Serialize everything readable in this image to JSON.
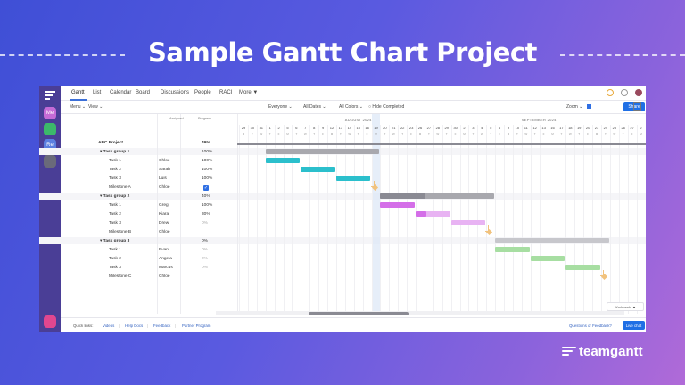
{
  "headline": "Sample Gantt Chart Project",
  "brand": "teamgantt",
  "rail": {
    "items": [
      {
        "label": "Me",
        "color": "#c46bd6"
      },
      {
        "label": "",
        "color": "#3cb86a"
      },
      {
        "label": "Re",
        "color": "#5b7fe0"
      },
      {
        "label": "",
        "color": "#6a6a7a"
      },
      {
        "label": "",
        "color": "#e0478f"
      }
    ]
  },
  "nav": {
    "tabs": [
      "Gantt",
      "List",
      "Calendar",
      "Board",
      "Discussions",
      "People",
      "RACI",
      "More ▼"
    ],
    "active": "Gantt"
  },
  "toolbar": {
    "menu": "Menu ⌄",
    "view": "View ⌄",
    "everyone": "Everyone ⌄",
    "all_dates": "All Dates ⌄",
    "all_colors": "All Colors ⌄",
    "hide_completed": "○ Hide Completed",
    "zoom": "Zoom ⌄",
    "share": "Share"
  },
  "columns": {
    "assigned": "Assigned",
    "progress": "Progress"
  },
  "project": {
    "name": "ABC Project",
    "progress": "49%"
  },
  "rows": [
    {
      "name": "▾ Task group 1",
      "assigned": "",
      "progress": "100%",
      "group": true
    },
    {
      "name": "Task 1",
      "assigned": "Chloe",
      "progress": "100%"
    },
    {
      "name": "Task 2",
      "assigned": "Sarah",
      "progress": "100%"
    },
    {
      "name": "Task 3",
      "assigned": "Luis",
      "progress": "100%"
    },
    {
      "name": "Milestone A",
      "assigned": "Chloe",
      "progress": "✓",
      "check": true
    },
    {
      "name": "▾ Task group 2",
      "assigned": "",
      "progress": "40%",
      "group": true
    },
    {
      "name": "Task 1",
      "assigned": "Greg",
      "progress": "100%"
    },
    {
      "name": "Task 2",
      "assigned": "Kiara",
      "progress": "30%"
    },
    {
      "name": "Task 3",
      "assigned": "Drew",
      "progress": "0%",
      "dim": true
    },
    {
      "name": "Milestone B",
      "assigned": "Chloe",
      "progress": "",
      "dim": true
    },
    {
      "name": "▾ Task group 3",
      "assigned": "",
      "progress": "0%",
      "group": true
    },
    {
      "name": "Task 1",
      "assigned": "Evan",
      "progress": "0%",
      "dim": true
    },
    {
      "name": "Task 2",
      "assigned": "Angela",
      "progress": "0%",
      "dim": true
    },
    {
      "name": "Task 3",
      "assigned": "Marcus",
      "progress": "0%",
      "dim": true
    },
    {
      "name": "Milestone C",
      "assigned": "Chloe",
      "progress": "",
      "dim": true
    }
  ],
  "timeline": {
    "months": [
      "AUGUST 2024",
      "SEPTEMBER 2024"
    ],
    "days": [
      "29",
      "30",
      "31",
      "1",
      "2",
      "5",
      "6",
      "7",
      "8",
      "9",
      "12",
      "13",
      "14",
      "15",
      "16",
      "19",
      "20",
      "21",
      "22",
      "23",
      "26",
      "27",
      "28",
      "29",
      "30",
      "2",
      "3",
      "4",
      "5",
      "6",
      "9",
      "10",
      "11",
      "12",
      "13",
      "16",
      "17",
      "18",
      "19",
      "20",
      "23",
      "24",
      "25",
      "26",
      "27",
      "2"
    ],
    "weekdays": [
      "M",
      "T",
      "W",
      "T",
      "F",
      "M",
      "T",
      "W",
      "T",
      "F",
      "M",
      "T",
      "W",
      "T",
      "F",
      "M",
      "T",
      "W",
      "T",
      "F",
      "M",
      "T",
      "W",
      "T",
      "F",
      "M",
      "T",
      "W",
      "T",
      "F",
      "M",
      "T",
      "W",
      "T",
      "F",
      "M",
      "T",
      "W",
      "T",
      "F",
      "M",
      "T",
      "W",
      "T",
      "F",
      "M"
    ],
    "today_index": 15
  },
  "bars": [
    {
      "row": 0,
      "start": 3,
      "end": 16,
      "color": "#a8a8ae",
      "done": 1
    },
    {
      "row": 1,
      "start": 3,
      "end": 7,
      "color": "#2bbfcc",
      "done": 1
    },
    {
      "row": 2,
      "start": 7,
      "end": 11,
      "color": "#2bbfcc",
      "done": 1
    },
    {
      "row": 3,
      "start": 11,
      "end": 15,
      "color": "#2bbfcc",
      "done": 1
    },
    {
      "row": 5,
      "start": 16,
      "end": 29,
      "color": "#a8a8ae",
      "done": 0.4
    },
    {
      "row": 6,
      "start": 16,
      "end": 20,
      "color": "#d46ee8",
      "done": 1
    },
    {
      "row": 7,
      "start": 20,
      "end": 24,
      "color": "#e8b3f3",
      "done": 0.3,
      "done_color": "#d46ee8"
    },
    {
      "row": 8,
      "start": 24,
      "end": 28,
      "color": "#e8b3f3",
      "done": 0
    },
    {
      "row": 10,
      "start": 29,
      "end": 42,
      "color": "#c7c7cc",
      "done": 0
    },
    {
      "row": 11,
      "start": 29,
      "end": 33,
      "color": "#a7dea2",
      "done": 0
    },
    {
      "row": 12,
      "start": 33,
      "end": 37,
      "color": "#a7dea2",
      "done": 0
    },
    {
      "row": 13,
      "start": 37,
      "end": 41,
      "color": "#a7dea2",
      "done": 0
    }
  ],
  "milestones": [
    {
      "row": 4,
      "at": 15
    },
    {
      "row": 9,
      "at": 28
    },
    {
      "row": 14,
      "at": 41
    }
  ],
  "workload": "Workloads ▲",
  "footer": {
    "quick_links": "Quick links:",
    "links": [
      "Videos",
      "Help Docs",
      "Feedback",
      "Partner Program"
    ],
    "questions": "Questions or Feedback?",
    "live_chat": "Live chat"
  }
}
